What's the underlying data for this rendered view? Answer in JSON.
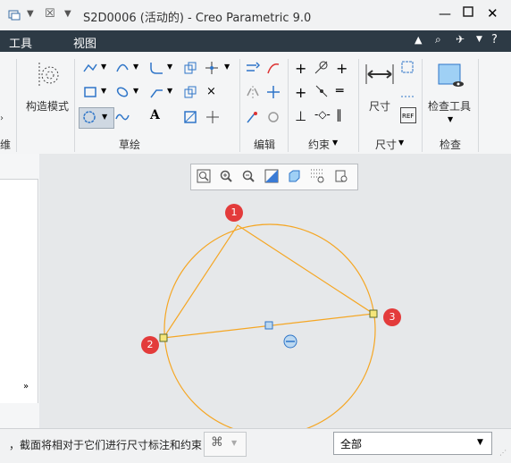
{
  "window": {
    "title": "S2D0006 (活动的) - Creo Parametric 9.0"
  },
  "menu": {
    "items": [
      "工具",
      "视图"
    ]
  },
  "ribbon": {
    "construction_mode": "构造模式",
    "groups": {
      "sketch": "草绘",
      "edit": "编辑",
      "constrain": "约束",
      "dimension": "尺寸",
      "inspect": "检查"
    },
    "dimension_button": "尺寸",
    "inspect_button": "检查工具",
    "ref_label": "REF",
    "left_cut_label": "维"
  },
  "canvas": {
    "points": [
      "1",
      "2",
      "3"
    ]
  },
  "status": {
    "message": "，截面将相对于它们进行尺寸标注和约束",
    "filter_value": "全部"
  },
  "colors": {
    "menubar": "#2d3a45",
    "curve": "#f5a623",
    "badge": "#e33b3b",
    "point_fill": "#f5e67a"
  }
}
